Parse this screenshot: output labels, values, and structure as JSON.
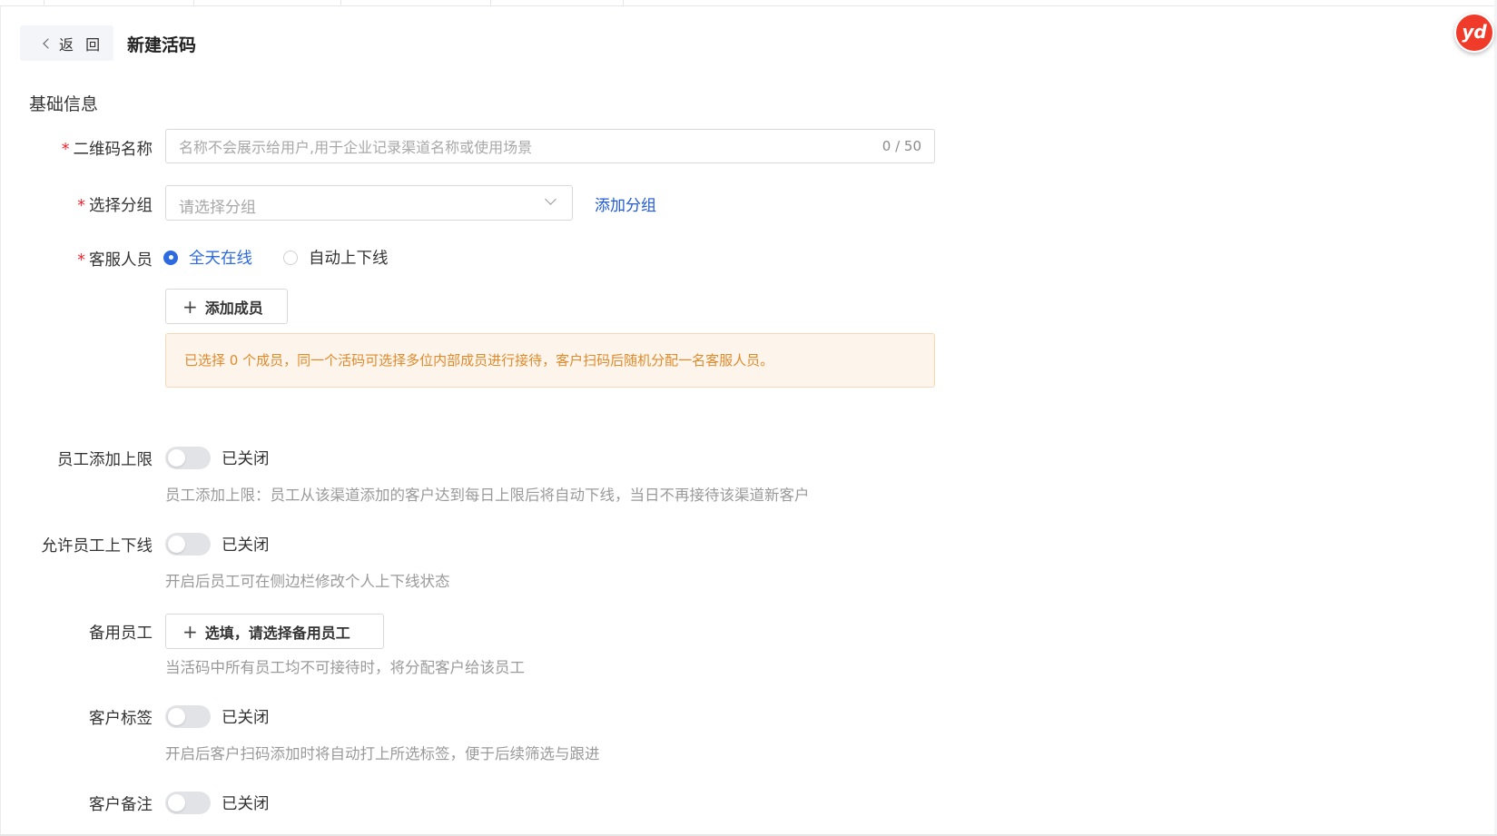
{
  "header": {
    "back_label": "返 回",
    "title": "新建活码"
  },
  "section": {
    "basic_info": "基础信息"
  },
  "fields": {
    "qr_name": {
      "label": "二维码名称",
      "placeholder": "名称不会展示给用户,用于企业记录渠道名称或使用场景",
      "value": "",
      "counter": "0 / 50"
    },
    "group": {
      "label": "选择分组",
      "placeholder": "请选择分组",
      "add_link": "添加分组"
    },
    "service_staff": {
      "label": "客服人员",
      "options": [
        "全天在线",
        "自动上下线"
      ],
      "selected": "全天在线",
      "add_member": "添加成员",
      "notice": "已选择 0 个成员，同一个活码可选择多位内部成员进行接待，客户扫码后随机分配一名客服人员。"
    },
    "staff_limit": {
      "label": "员工添加上限",
      "state": "已关闭",
      "hint": "员工添加上限：员工从该渠道添加的客户达到每日上限后将自动下线，当日不再接待该渠道新客户"
    },
    "allow_online": {
      "label": "允许员工上下线",
      "state": "已关闭",
      "hint": "开启后员工可在侧边栏修改个人上下线状态"
    },
    "backup_staff": {
      "label": "备用员工",
      "button": "选填，请选择备用员工",
      "hint": "当活码中所有员工均不可接待时，将分配客户给该员工"
    },
    "customer_tag": {
      "label": "客户标签",
      "state": "已关闭",
      "hint": "开启后客户扫码添加时将自动打上所选标签，便于后续筛选与跟进"
    },
    "customer_remark": {
      "label": "客户备注",
      "state": "已关闭"
    }
  },
  "avatar": {
    "text": "yd"
  },
  "colors": {
    "primary": "#2d6ae0",
    "link": "#1f5ad8",
    "required": "#f5222d",
    "notice_bg": "#fdf5ec",
    "notice_text": "#e08a2b",
    "avatar_bg": "#f03a2a"
  }
}
